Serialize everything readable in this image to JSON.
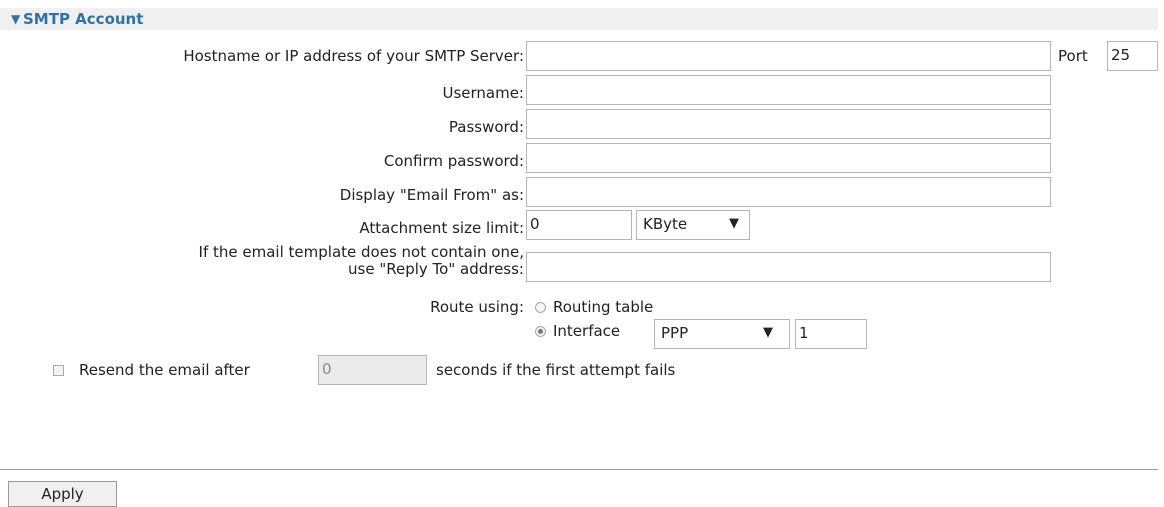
{
  "section": {
    "title": "SMTP Account"
  },
  "fields": {
    "hostname": {
      "label": "Hostname or IP address of your SMTP Server:",
      "value": ""
    },
    "port": {
      "label": "Port",
      "value": "25"
    },
    "username": {
      "label": "Username:",
      "value": ""
    },
    "password": {
      "label": "Password:",
      "value": ""
    },
    "confirm_password": {
      "label": "Confirm password:",
      "value": ""
    },
    "email_from": {
      "label": "Display \"Email From\" as:",
      "value": ""
    },
    "attachment": {
      "label": "Attachment size limit:",
      "value": "0",
      "unit": "KByte",
      "caret": "▼"
    },
    "reply_to": {
      "label_line1": "If the email template does not contain one,",
      "label_line2": "use \"Reply To\" address:",
      "value": ""
    }
  },
  "route": {
    "label": "Route using:",
    "option_routing_table": "Routing table",
    "option_interface": "Interface",
    "selected": "interface",
    "interface_type": "PPP",
    "interface_number": "1",
    "caret": "▼"
  },
  "resend": {
    "checked": false,
    "text_before": "Resend the email after",
    "value": "0",
    "text_after": "seconds if the first attempt fails"
  },
  "apply_label": "Apply",
  "colors": {
    "header_text": "#2d73a6",
    "header_bg": "#f0f0f0"
  },
  "icons": {
    "section_toggle": "caret-down-icon"
  }
}
